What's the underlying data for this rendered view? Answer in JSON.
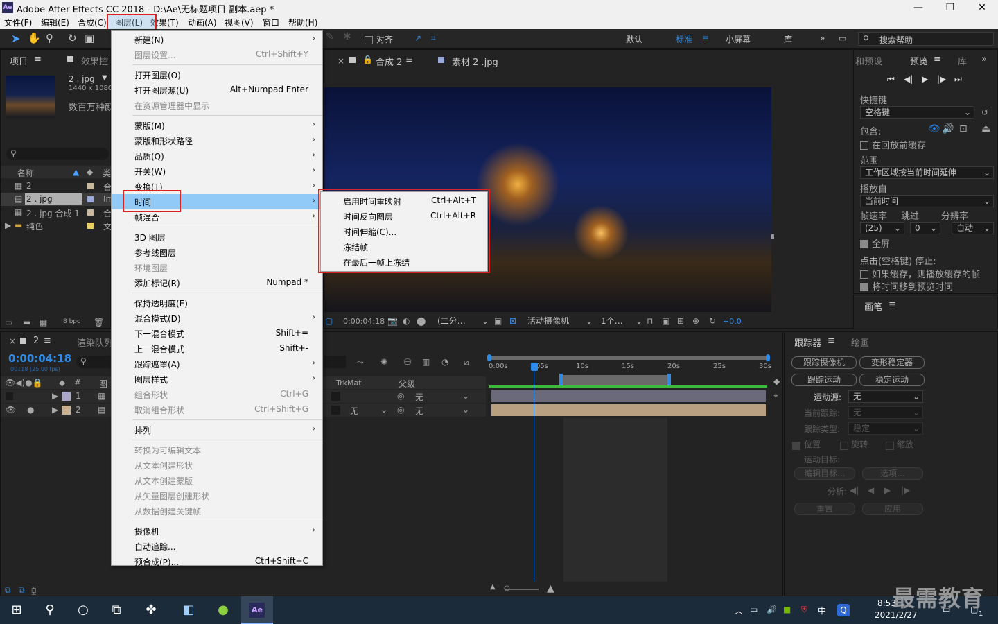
{
  "window": {
    "app_icon": "Ae",
    "title": "Adobe After Effects CC 2018 - D:\\Ae\\无标题项目 副本.aep *",
    "minimize": "—",
    "maximize": "❐",
    "close": "✕"
  },
  "menubar": {
    "items": [
      "文件(F)",
      "编辑(E)",
      "合成(C)",
      "图层(L)",
      "效果(T)",
      "动画(A)",
      "视图(V)",
      "窗口",
      "帮助(H)"
    ]
  },
  "toolbar": {
    "snap_label": "对齐",
    "workspaces": [
      "默认",
      "标准",
      "小屏幕",
      "库"
    ],
    "search_help": "搜索帮助"
  },
  "project_panel": {
    "tab_project": "项目",
    "tab_effects": "效果控",
    "thumb_name": "2 . jpg",
    "thumb_size": "1440 x 1080 (",
    "thumb_usage": "数百万种颜",
    "col_name": "名称",
    "col_type": "类",
    "items": [
      {
        "name": "2",
        "type": "合"
      },
      {
        "name": "2 . jpg",
        "type": "Im"
      },
      {
        "name": "2 . jpg 合成 1",
        "type": "合"
      },
      {
        "name": "纯色",
        "type": "文"
      }
    ],
    "bpc": "8 bpc"
  },
  "comp_tabs": {
    "comp_tab": "合成 2",
    "footage_tab": "素材 2 .jpg"
  },
  "viewer_footer": {
    "timecode": "0:00:04:18",
    "resolution": "(二分…",
    "camera": "活动摄像机",
    "views": "1个…",
    "exposure": "+0.0"
  },
  "preview_panel": {
    "tab_presets": "和预设",
    "tab_preview": "预览",
    "tab_library": "库",
    "shortcut_label": "快捷键",
    "shortcut_value": "空格键",
    "include_label": "包含:",
    "cache_before": "在回放前缓存",
    "range_label": "范围",
    "range_value": "工作区域按当前时间延伸",
    "play_from_label": "播放自",
    "play_from_value": "当前时间",
    "fps_label": "帧速率",
    "skip_label": "跳过",
    "res_label": "分辨率",
    "fps_value": "(25)",
    "skip_value": "0",
    "res_value": "自动",
    "fullscreen": "全屏",
    "stop_label": "点击(空格键) 停止:",
    "if_cache": "如果缓存，则播放缓存的帧",
    "move_time": "将时间移到预览时间",
    "brush_tab": "画笔"
  },
  "timeline": {
    "comp_name": "2",
    "render_queue": "渲染队列",
    "timecode": "0:00:04:18",
    "frame_info": "00118 (25.00 fps)",
    "col_layer": "图",
    "col_trkmat": "TrkMat",
    "col_parent": "父级",
    "ruler": [
      "0:00s",
      "05s",
      "10s",
      "15s",
      "20s",
      "25s",
      "30s"
    ],
    "layers": [
      {
        "num": "1",
        "trkmat": "",
        "parent": "无"
      },
      {
        "num": "2",
        "trkmat": "无",
        "parent": "无"
      }
    ]
  },
  "tracker_panel": {
    "tab_tracker": "跟踪器",
    "tab_paint": "绘画",
    "btn_track_camera": "跟踪摄像机",
    "btn_warp_stabilizer": "变形稳定器",
    "btn_track_motion": "跟踪运动",
    "btn_stabilize_motion": "稳定运动",
    "motion_source_label": "运动源:",
    "motion_source_value": "无",
    "current_track_label": "当前跟踪:",
    "current_track_value": "无",
    "track_type_label": "跟踪类型:",
    "track_type_value": "稳定",
    "position": "位置",
    "rotation": "旋转",
    "scale": "缩放",
    "motion_target_label": "运动目标:",
    "edit_target": "编辑目标...",
    "options": "选项...",
    "analyze_label": "分析:",
    "reset": "重置",
    "apply": "应用"
  },
  "layer_menu": {
    "items": [
      {
        "label": "新建(N)",
        "shortcut": "",
        "submenu": true,
        "disabled": false
      },
      {
        "label": "图层设置...",
        "shortcut": "Ctrl+Shift+Y",
        "submenu": false,
        "disabled": true
      },
      {
        "label": "打开图层(O)",
        "shortcut": "",
        "submenu": false,
        "disabled": false
      },
      {
        "label": "打开图层源(U)",
        "shortcut": "Alt+Numpad Enter",
        "submenu": false,
        "disabled": false
      },
      {
        "label": "在资源管理器中显示",
        "shortcut": "",
        "submenu": false,
        "disabled": true
      },
      {
        "label": "蒙版(M)",
        "shortcut": "",
        "submenu": true,
        "disabled": false
      },
      {
        "label": "蒙版和形状路径",
        "shortcut": "",
        "submenu": true,
        "disabled": false
      },
      {
        "label": "品质(Q)",
        "shortcut": "",
        "submenu": true,
        "disabled": false
      },
      {
        "label": "开关(W)",
        "shortcut": "",
        "submenu": true,
        "disabled": false
      },
      {
        "label": "变换(T)",
        "shortcut": "",
        "submenu": true,
        "disabled": false
      },
      {
        "label": "时间",
        "shortcut": "",
        "submenu": true,
        "disabled": false
      },
      {
        "label": "帧混合",
        "shortcut": "",
        "submenu": true,
        "disabled": false
      },
      {
        "label": "3D 图层",
        "shortcut": "",
        "submenu": false,
        "disabled": false
      },
      {
        "label": "参考线图层",
        "shortcut": "",
        "submenu": false,
        "disabled": false
      },
      {
        "label": "环境图层",
        "shortcut": "",
        "submenu": false,
        "disabled": true
      },
      {
        "label": "添加标记(R)",
        "shortcut": "Numpad *",
        "submenu": false,
        "disabled": false
      },
      {
        "label": "保持透明度(E)",
        "shortcut": "",
        "submenu": false,
        "disabled": false
      },
      {
        "label": "混合模式(D)",
        "shortcut": "",
        "submenu": true,
        "disabled": false
      },
      {
        "label": "下一混合模式",
        "shortcut": "Shift+=",
        "submenu": false,
        "disabled": false
      },
      {
        "label": "上一混合模式",
        "shortcut": "Shift+-",
        "submenu": false,
        "disabled": false
      },
      {
        "label": "跟踪遮罩(A)",
        "shortcut": "",
        "submenu": true,
        "disabled": false
      },
      {
        "label": "图层样式",
        "shortcut": "",
        "submenu": true,
        "disabled": false
      },
      {
        "label": "组合形状",
        "shortcut": "Ctrl+G",
        "submenu": false,
        "disabled": true
      },
      {
        "label": "取消组合形状",
        "shortcut": "Ctrl+Shift+G",
        "submenu": false,
        "disabled": true
      },
      {
        "label": "排列",
        "shortcut": "",
        "submenu": true,
        "disabled": false
      },
      {
        "label": "转换为可编辑文本",
        "shortcut": "",
        "submenu": false,
        "disabled": true
      },
      {
        "label": "从文本创建形状",
        "shortcut": "",
        "submenu": false,
        "disabled": true
      },
      {
        "label": "从文本创建蒙版",
        "shortcut": "",
        "submenu": false,
        "disabled": true
      },
      {
        "label": "从矢量图层创建形状",
        "shortcut": "",
        "submenu": false,
        "disabled": true
      },
      {
        "label": "从数据创建关键帧",
        "shortcut": "",
        "submenu": false,
        "disabled": true
      },
      {
        "label": "摄像机",
        "shortcut": "",
        "submenu": true,
        "disabled": false
      },
      {
        "label": "自动追踪...",
        "shortcut": "",
        "submenu": false,
        "disabled": false
      },
      {
        "label": "预合成(P)...",
        "shortcut": "Ctrl+Shift+C",
        "submenu": false,
        "disabled": false
      }
    ]
  },
  "time_submenu": {
    "items": [
      {
        "label": "启用时间重映射",
        "shortcut": "Ctrl+Alt+T"
      },
      {
        "label": "时间反向图层",
        "shortcut": "Ctrl+Alt+R"
      },
      {
        "label": "时间伸缩(C)...",
        "shortcut": ""
      },
      {
        "label": "冻结帧",
        "shortcut": ""
      },
      {
        "label": "在最后一帧上冻结",
        "shortcut": ""
      }
    ]
  },
  "taskbar": {
    "ime": "中",
    "time": "8:53",
    "date": "2021/2/27",
    "notification_count": "1",
    "watermark": "最需教育"
  }
}
